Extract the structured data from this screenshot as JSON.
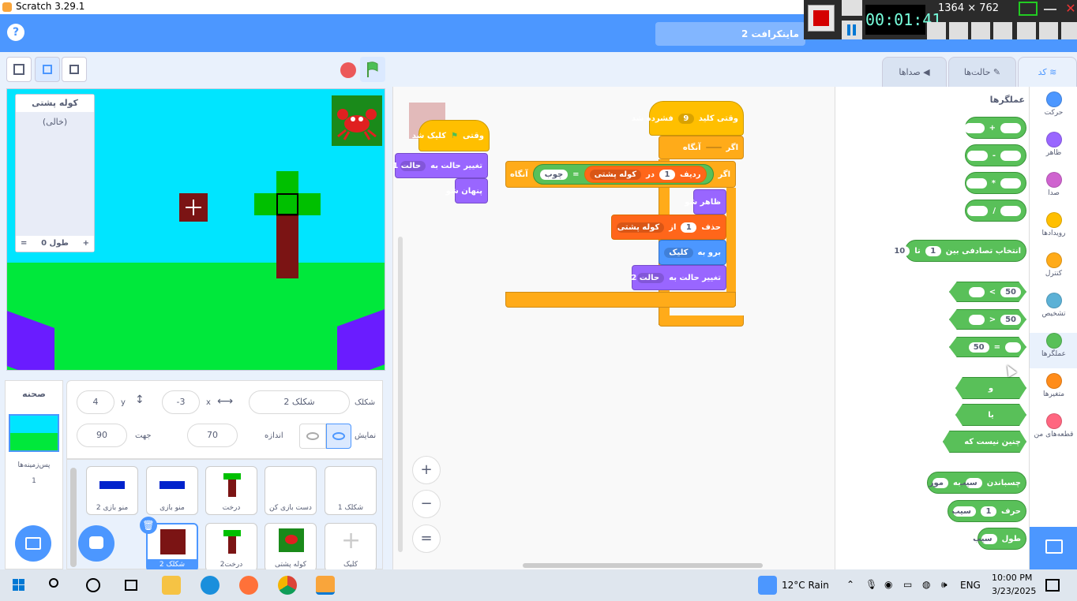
{
  "window": {
    "title": "Scratch 3.29.1"
  },
  "recorder": {
    "time": "00:01:41",
    "dims": "1364 × 762"
  },
  "menubar": {
    "help": "?",
    "project_title": "ماینکرافت 2"
  },
  "tabs": {
    "code": "کد",
    "costumes": "حالت‌ها",
    "sounds": "صداها"
  },
  "stage": {
    "list_monitor": {
      "title": "کوله پشتی",
      "empty": "(خالی)",
      "length": "طول 0",
      "plus": "+",
      "equals": "="
    }
  },
  "sprite_info": {
    "sprite_label": "شکلک",
    "sprite_name": "شکلک 2",
    "x_label": "x",
    "x_value": "-3",
    "y_label": "y",
    "y_value": "4",
    "show_label": "نمایش",
    "size_label": "اندازه",
    "size_value": "70",
    "direction_label": "جهت",
    "direction_value": "90"
  },
  "sprites": [
    {
      "name": "شکلک 1"
    },
    {
      "name": "دست بازی کن"
    },
    {
      "name": "درخت"
    },
    {
      "name": "منو بازی"
    },
    {
      "name": "منو بازی 2"
    },
    {
      "name": "کلیک"
    },
    {
      "name": "کوله پشتی"
    },
    {
      "name": "درخت2"
    },
    {
      "name": "شکلک 2"
    }
  ],
  "stage_pane": {
    "title": "صحنه",
    "backdrops_label": "پس‌زمینه‌ها",
    "backdrops_count": "1"
  },
  "categories": [
    {
      "label": "حرکت",
      "color": "#4c97ff"
    },
    {
      "label": "ظاهر",
      "color": "#9966ff"
    },
    {
      "label": "صدا",
      "color": "#cf63cf"
    },
    {
      "label": "رویدادها",
      "color": "#ffbf00"
    },
    {
      "label": "کنترل",
      "color": "#ffab19"
    },
    {
      "label": "تشخیص",
      "color": "#5cb1d6"
    },
    {
      "label": "عملگرها",
      "color": "#59c059"
    },
    {
      "label": "متغیرها",
      "color": "#ff8c1a"
    },
    {
      "label": "قطعه‌های من",
      "color": "#ff6680"
    }
  ],
  "palette": {
    "heading": "عملگرها",
    "add": "+",
    "sub": "-",
    "mul": "*",
    "div": "/",
    "random": "انتخاب تصادفی بین",
    "random_a": "1",
    "random_to": "تا",
    "random_b": "10",
    "gt": ">",
    "lt": "<",
    "eq": "=",
    "fifty": "50",
    "and": "و",
    "or": "یا",
    "not": "چنین نیست که",
    "join": "چسباندن",
    "join_a": "سیب",
    "join_to": "به",
    "join_b": "موز",
    "letter": "حرف",
    "letter_n": "1",
    "letter_of": "سیب",
    "length": "طول",
    "length_of": "سیب"
  },
  "scripts": {
    "s1_hat": "وقتی",
    "s1_clicked": "کلیک شد",
    "s1_switch": "تغییر حالت به",
    "s1_costume": "حالت 1",
    "s1_hide": "پنهان شو",
    "s2_hat": "وقتی کلید",
    "s2_key": "9",
    "s2_pressed": "فشرده شد",
    "s2_if": "اگر",
    "s2_then": "آنگاه",
    "s2_if2": "اگر",
    "s2_item": "ردیف",
    "s2_item_n": "1",
    "s2_in": "در",
    "s2_list": "کوله پشتی",
    "s2_eq": "=",
    "s2_wood": "چوب",
    "s2_then2": "آنگاه",
    "s2_show": "ظاهر شو",
    "s2_delete": "حذف",
    "s2_delete_n": "1",
    "s2_of": "از",
    "s2_list2": "کوله پشتی",
    "s2_goto": "برو به",
    "s2_goto_target": "کلیک",
    "s2_switch": "تغییر حالت به",
    "s2_costume": "حالت 2"
  },
  "zoom": {
    "in": "+",
    "out": "−",
    "reset": "="
  },
  "taskbar": {
    "weather": "12°C  Rain",
    "lang": "ENG",
    "time": "10:00 PM",
    "date": "3/23/2025"
  }
}
